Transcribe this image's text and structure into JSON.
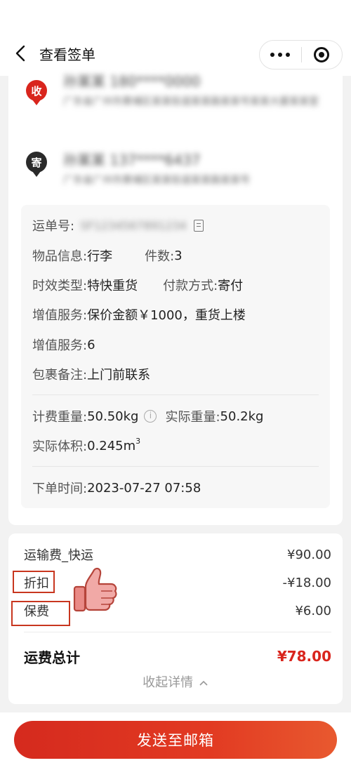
{
  "nav": {
    "title": "查看签单"
  },
  "receiver": {
    "badge": "收",
    "name": "孙某某 180****0000",
    "address": "广东省广州市黄埔区某某街道某某路某某号某某大厦某某室"
  },
  "sender": {
    "badge": "寄",
    "name": "孙某某 137****6437",
    "address": "广东省广州市黄埔区某某街道某某路某某号"
  },
  "details": {
    "waybill_label": "运单号:",
    "waybill_value": "SF1234567891234",
    "item_label": "物品信息:",
    "item_value": "行李",
    "count_label": "件数:",
    "count_value": "3",
    "timeliness_label": "时效类型:",
    "timeliness_value": "特快重货",
    "payment_label": "付款方式:",
    "payment_value": "寄付",
    "vas1_label": "增值服务:",
    "vas1_value": "保价金额￥1000，重货上楼",
    "vas2_label": "增值服务:",
    "vas2_value": "6",
    "remark_label": "包裹备注:",
    "remark_value": "上门前联系",
    "charge_weight_label": "计费重量:",
    "charge_weight_value": "50.50kg",
    "actual_weight_label": "实际重量:",
    "actual_weight_value": "50.2kg",
    "volume_label": "实际体积:",
    "volume_value": "0.245m",
    "volume_sup": "3",
    "order_time_label": "下单时间:",
    "order_time_value": "2023-07-27 07:58"
  },
  "fees": [
    {
      "label": "运输费_快运",
      "value": "¥90.00"
    },
    {
      "label": "折扣",
      "value": "-¥18.00"
    },
    {
      "label": "保费",
      "value": "¥6.00"
    }
  ],
  "total": {
    "label": "运费总计",
    "value": "¥78.00"
  },
  "collapse_label": "收起详情",
  "send_button": "发送至邮箱",
  "colors": {
    "brand_red": "#d9251d",
    "highlight_box": "#c8361f"
  }
}
